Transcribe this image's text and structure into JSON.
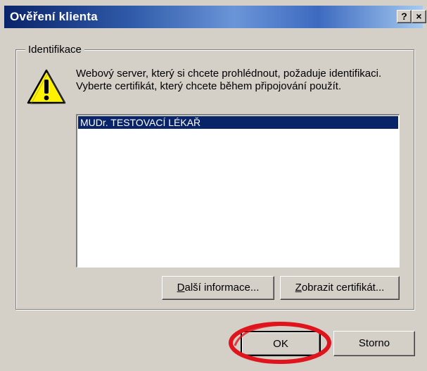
{
  "window": {
    "title": "Ověření klienta",
    "help_glyph": "?",
    "close_glyph": "×"
  },
  "group": {
    "label": "Identifikace"
  },
  "message": "Webový server, který si chcete prohlédnout, požaduje identifikaci. Vyberte certifikát, který chcete během připojování použít.",
  "certificates": {
    "items": [
      {
        "label": "MUDr. TESTOVACÍ LÉKAŘ",
        "selected": true
      }
    ]
  },
  "buttons": {
    "info": {
      "mnemonic": "D",
      "rest": "alší informace..."
    },
    "view_cert": {
      "mnemonic": "Z",
      "rest": "obrazit certifikát..."
    },
    "ok": "OK",
    "cancel": "Storno"
  },
  "colors": {
    "title_start": "#0a246a",
    "selection": "#0a246a",
    "highlight_circle": "#e0141c",
    "dialog_face": "#d4d0c8"
  },
  "icons": {
    "warning": "warning-triangle-icon",
    "help": "help-icon",
    "close": "close-icon"
  }
}
